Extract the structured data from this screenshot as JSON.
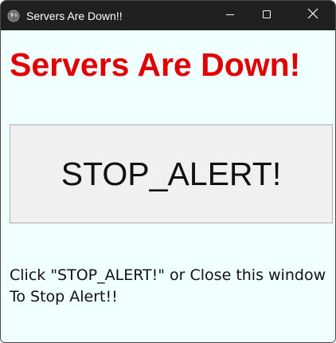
{
  "window": {
    "title": "Servers Are Down!!",
    "controls": {
      "minimize_icon": "minimize-icon",
      "maximize_icon": "maximize-icon",
      "close_icon": "close-icon"
    },
    "app_icon": "globe-icon"
  },
  "main": {
    "heading": "Servers Are Down!",
    "stop_button_label": "STOP_ALERT!",
    "instructions": [
      "Click \"STOP_ALERT!\" or Close this window",
      "To Stop Alert!!"
    ]
  },
  "colors": {
    "titlebar": "#202020",
    "background": "#f0ffff",
    "heading": "#e00000",
    "button_face": "#f0f0f0",
    "button_border": "#adadad"
  }
}
